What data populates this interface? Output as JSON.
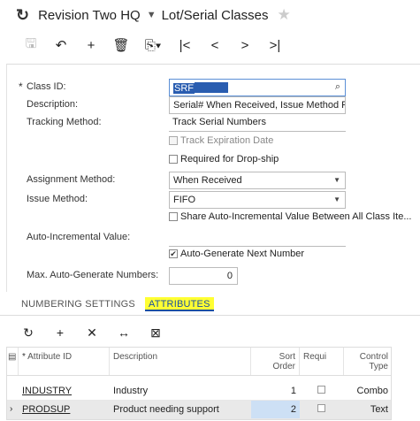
{
  "header": {
    "company": "Revision Two HQ",
    "screen_title": "Lot/Serial Classes"
  },
  "form": {
    "class_id_label": "Class ID:",
    "class_id_value": "SRF",
    "description_label": "Description:",
    "description_value": "Serial# When Received, Issue Method F",
    "tracking_label": "Tracking Method:",
    "tracking_value": "Track Serial Numbers",
    "track_expiration": "Track Expiration Date",
    "required_dropship": "Required for Drop-ship",
    "assignment_label": "Assignment Method:",
    "assignment_value": "When Received",
    "issue_label": "Issue Method:",
    "issue_value": "FIFO",
    "share_auto": "Share Auto-Incremental Value Between All Class Ite...",
    "auto_inc_label": "Auto-Incremental Value:",
    "auto_generate": "Auto-Generate Next Number",
    "max_auto_label": "Max. Auto-Generate Numbers:",
    "max_auto_value": "0"
  },
  "tabs": {
    "numbering": "NUMBERING SETTINGS",
    "attributes": "ATTRIBUTES"
  },
  "grid": {
    "headers": {
      "attribute_id": "Attribute ID",
      "description": "Description",
      "sort_order_1": "Sort",
      "sort_order_2": "Order",
      "required": "Requi",
      "control_1": "Control",
      "control_2": "Type"
    },
    "rows": [
      {
        "attribute_id": "INDUSTRY",
        "description": "Industry",
        "sort_order": "1",
        "control_type": "Combo"
      },
      {
        "attribute_id": "PRODSUP",
        "description": "Product needing support",
        "sort_order": "2",
        "control_type": "Text"
      }
    ]
  }
}
